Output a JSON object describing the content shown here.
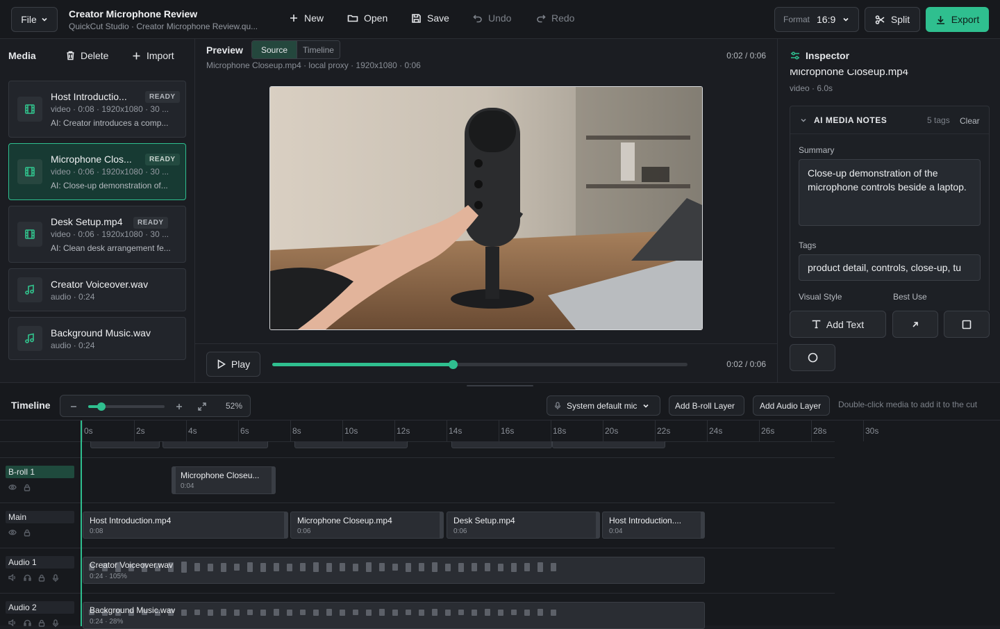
{
  "topbar": {
    "file_menu": "File",
    "project_title": "Creator Microphone Review",
    "project_path": "QuickCut Studio · Creator Microphone Review.qu...",
    "new": "New",
    "open": "Open",
    "save": "Save",
    "undo": "Undo",
    "redo": "Redo",
    "format_label": "Format",
    "format_value": "16:9",
    "split": "Split",
    "export": "Export"
  },
  "colors": {
    "accent": "#2fbf8f",
    "background": "#1b1d22",
    "panel_border": "#2a2d33"
  },
  "media": {
    "title": "Media",
    "delete": "Delete",
    "import": "Import",
    "items": [
      {
        "name": "Host Introductio...",
        "badge": "READY",
        "meta": "video · 0:08 · 1920x1080 · 30 ...",
        "note": "AI: Creator introduces a comp...",
        "icon": "film-icon",
        "selected": false
      },
      {
        "name": "Microphone Clos...",
        "badge": "READY",
        "meta": "video · 0:06 · 1920x1080 · 30 ...",
        "note": "AI: Close-up demonstration of...",
        "icon": "film-icon",
        "selected": true
      },
      {
        "name": "Desk Setup.mp4",
        "badge": "READY",
        "meta": "video · 0:06 · 1920x1080 · 30 ...",
        "note": "AI: Clean desk arrangement fe...",
        "icon": "film-icon",
        "selected": false
      },
      {
        "name": "Creator Voiceover.wav",
        "meta": "audio · 0:24",
        "icon": "music-icon",
        "selected": false
      },
      {
        "name": "Background Music.wav",
        "meta": "audio · 0:24",
        "icon": "music-icon",
        "selected": false
      }
    ]
  },
  "preview": {
    "title": "Preview",
    "tab_source": "Source",
    "tab_timeline": "Timeline",
    "file_info": "Microphone Closeup.mp4 · local proxy · 1920x1080 · 0:06",
    "time_top": "0:02 / 0:06",
    "play": "Play",
    "time_bottom": "0:02 / 0:06",
    "progress": 0.4
  },
  "inspector": {
    "title": "Inspector",
    "clip_name": "Microphone Closeup.mp4",
    "clip_meta": "video · 6.0s",
    "notes_title": "AI MEDIA NOTES",
    "tag_count": "5 tags",
    "clear": "Clear",
    "summary_label": "Summary",
    "summary": "Close-up demonstration of the microphone controls beside a laptop.",
    "tags_label": "Tags",
    "tags": "product detail, controls, close-up, tu",
    "visual_style_label": "Visual Style",
    "best_use_label": "Best Use",
    "add_text": "Add Text"
  },
  "timeline": {
    "title": "Timeline",
    "zoom": "52%",
    "zoom_level": 0.17,
    "mic": "System default mic",
    "add_broll": "Add B-roll Layer",
    "add_audio": "Add Audio Layer",
    "hint": "Double-click media to add it to the cut",
    "ruler": [
      "0s",
      "2s",
      "4s",
      "6s",
      "8s",
      "10s",
      "12s",
      "14s",
      "16s",
      "18s",
      "20s",
      "22s",
      "24s",
      "26s",
      "28s",
      "30s"
    ],
    "tracks": {
      "broll": "B-roll 1",
      "main": "Main",
      "audio1": "Audio 1",
      "audio2": "Audio 2"
    },
    "clips": {
      "broll_clip": {
        "name": "Microphone Closeu...",
        "dur": "0:04"
      },
      "main": [
        {
          "name": "Host Introduction.mp4",
          "dur": "0:08"
        },
        {
          "name": "Microphone Closeup.mp4",
          "dur": "0:06"
        },
        {
          "name": "Desk Setup.mp4",
          "dur": "0:06"
        },
        {
          "name": "Host Introduction....",
          "dur": "0:04"
        }
      ],
      "audio1": {
        "name": "Creator Voiceover.wav",
        "dur": "0:24 · 105%"
      },
      "audio2": {
        "name": "Background Music.wav",
        "dur": "0:24 · 28%"
      }
    }
  }
}
